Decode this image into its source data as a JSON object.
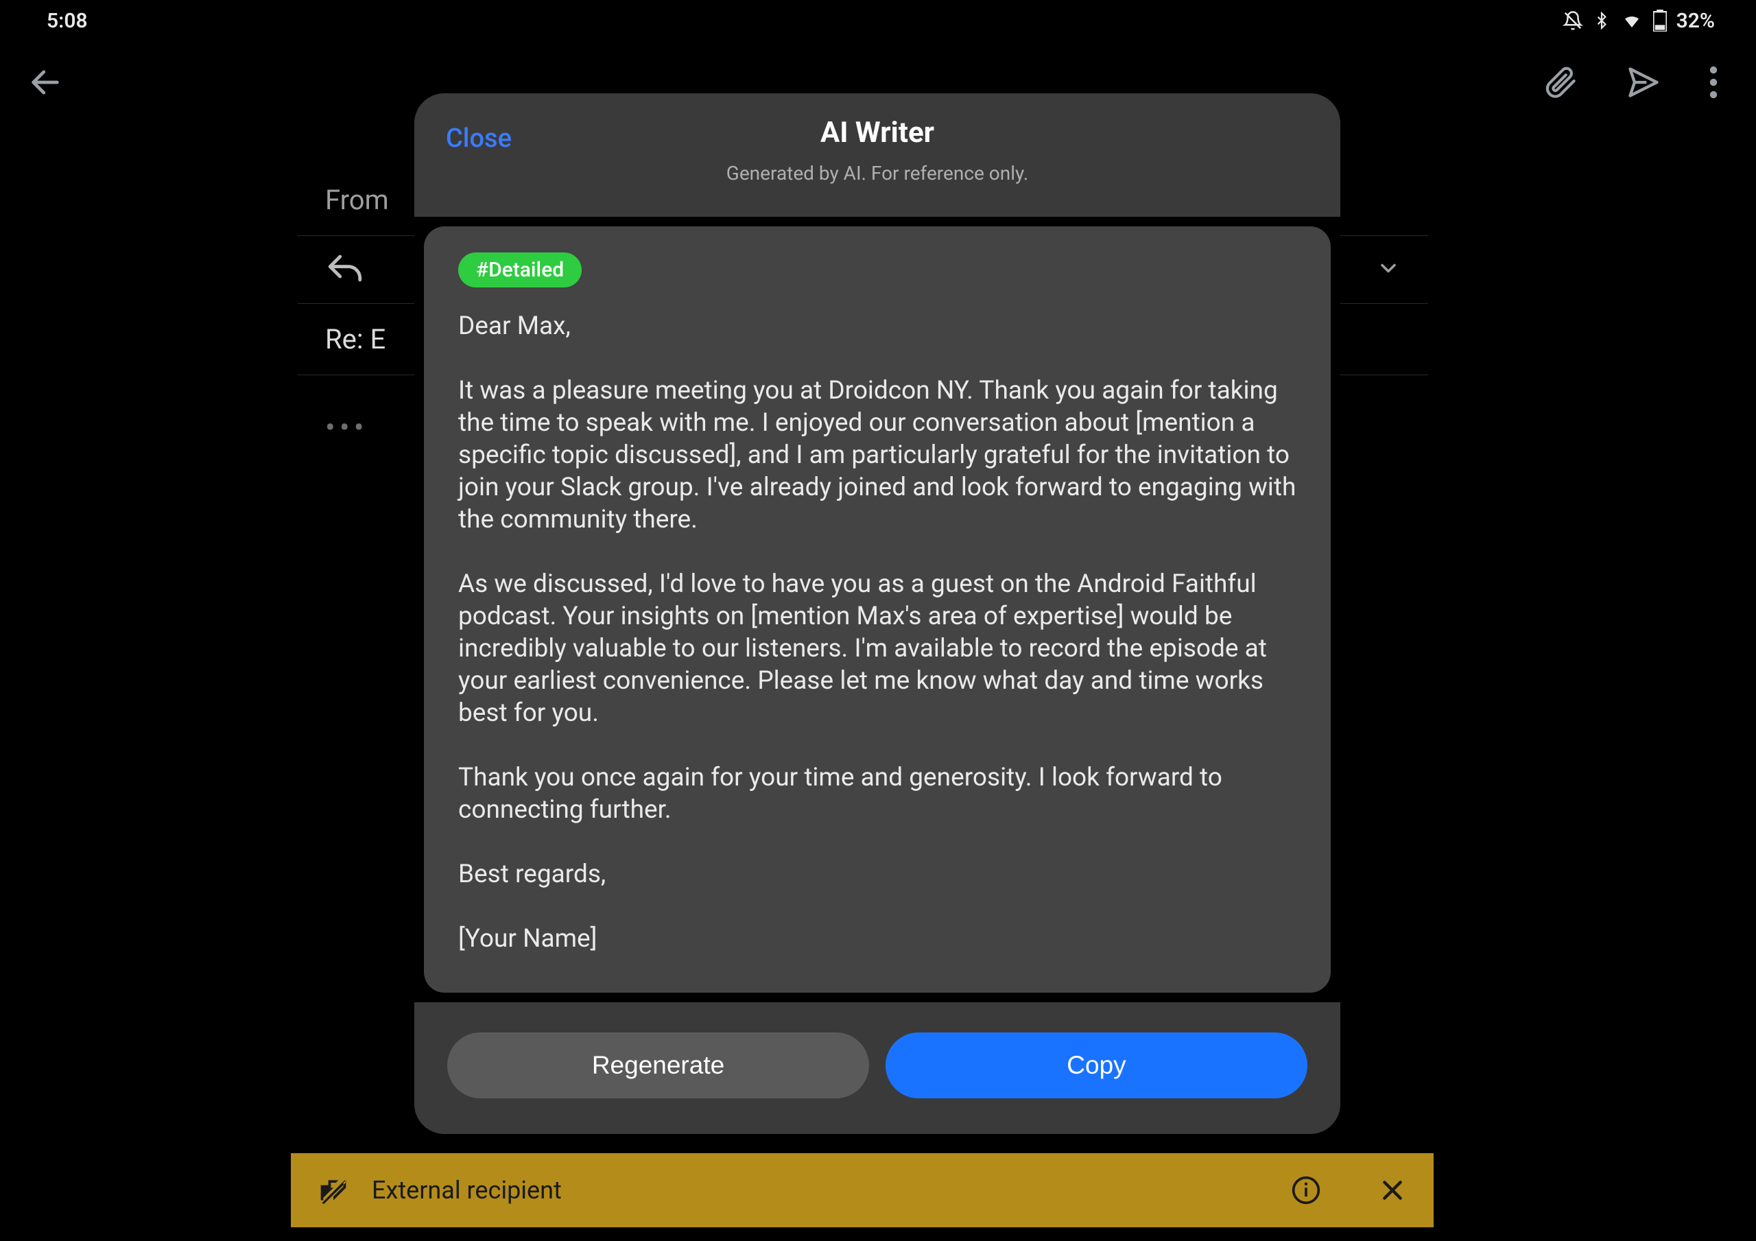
{
  "status": {
    "time": "5:08",
    "battery": "32%"
  },
  "appbar": {},
  "compose": {
    "from_label": "From",
    "subject": "Re: E",
    "expand_dots": "•••"
  },
  "banner": {
    "text": "External recipient"
  },
  "dialog": {
    "close": "Close",
    "title": "AI Writer",
    "subtitle": "Generated by AI. For reference only.",
    "tag": "#Detailed",
    "body": "Dear Max,\n\nIt was a pleasure meeting you at Droidcon NY. Thank you again for taking the time to speak with me. I enjoyed our conversation about [mention a specific topic discussed], and I am particularly grateful for the invitation to join your Slack group. I've already joined and look forward to engaging with the community there.\n\nAs we discussed, I'd love to have you as a guest on the Android Faithful podcast. Your insights on [mention Max's area of expertise] would be incredibly valuable to our listeners. I'm available to record the episode at your earliest convenience. Please let me know what day and time works best for you.\n\nThank you once again for your time and generosity. I look forward to connecting further.\n\nBest regards,\n\n[Your Name]",
    "regenerate": "Regenerate",
    "copy": "Copy"
  }
}
